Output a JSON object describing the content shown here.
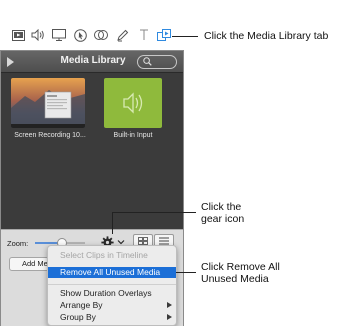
{
  "toolbar": {
    "icons": [
      "media-library-icon-a",
      "audio-icon",
      "screen-icon",
      "cursor-icon",
      "transition-icon",
      "annotation-icon",
      "text-icon",
      "media-library-tab-icon"
    ]
  },
  "panel": {
    "title": "Media Library",
    "items": [
      {
        "label": "Screen Recording 10...",
        "kind": "video"
      },
      {
        "label": "Built-in Input",
        "kind": "audio"
      }
    ]
  },
  "footer": {
    "zoom_label": "Zoom:",
    "zoom_level": 0.45,
    "add_button": "Add Me"
  },
  "menu": {
    "items": [
      {
        "label": "Select Clips in Timeline",
        "state": "disabled"
      },
      {
        "label": "Remove All Unused Media",
        "state": "selected"
      },
      {
        "label": "Show Duration Overlays",
        "state": "normal"
      },
      {
        "label": "Arrange By",
        "state": "submenu"
      },
      {
        "label": "Group By",
        "state": "submenu"
      }
    ]
  },
  "callouts": {
    "media_tab": "Click the Media Library tab",
    "gear_line1": "Click the",
    "gear_line2": "gear icon",
    "remove_line1": "Click Remove All",
    "remove_line2": "Unused Media"
  },
  "colors": {
    "accent": "#1c6fd7",
    "panel_bg": "#3b3b3b",
    "audio_tile": "#8fba3c"
  }
}
